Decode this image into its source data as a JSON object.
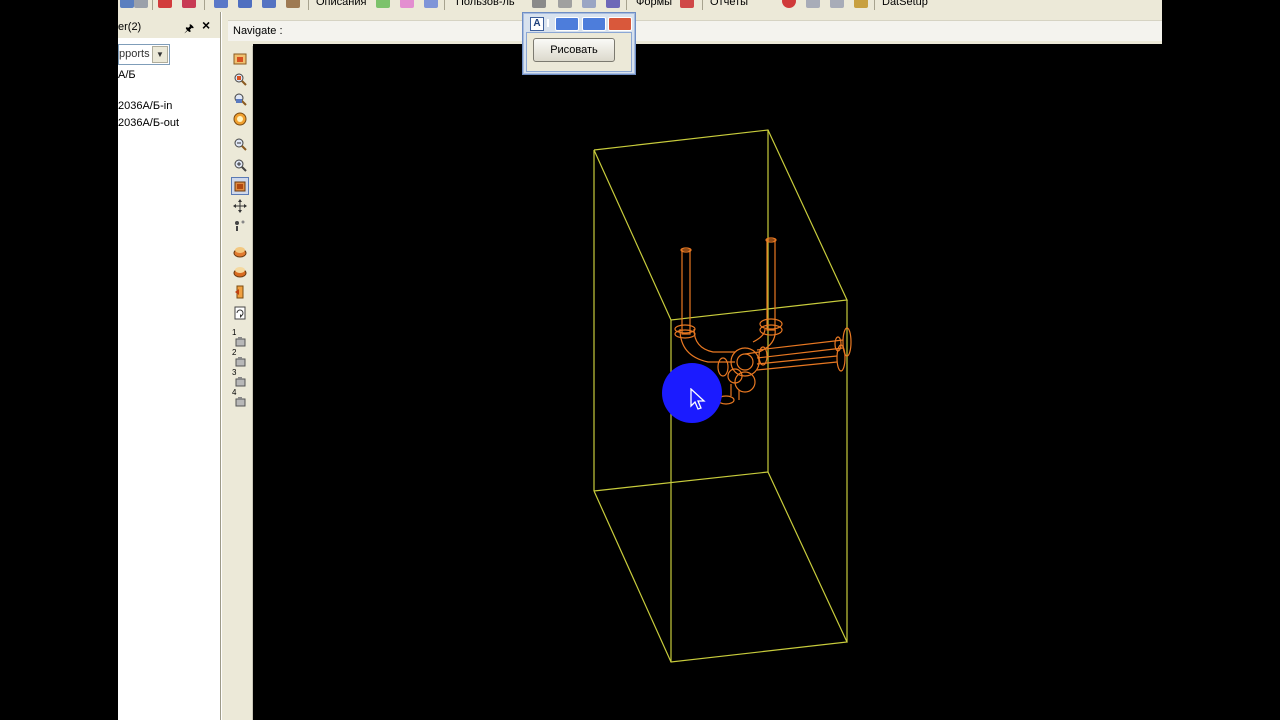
{
  "toolbar": {
    "menu_description": "Описания",
    "menu_user": "Пользов-ль",
    "menu_forms": "Формы",
    "menu_reports": "Отчеты",
    "menu_dataset": "DatSetup"
  },
  "explorer": {
    "title": "er(2)",
    "filter_value": "pports",
    "tree_items": [
      "А/Б",
      "2036А/Б-in",
      "2036А/Б-out"
    ]
  },
  "viewport": {
    "navigate_label": "Navigate :"
  },
  "side_toolbar": {
    "view_numbers": [
      "1",
      "2",
      "3",
      "4"
    ]
  },
  "draw_dialog": {
    "title_icon": "A",
    "draw_button_label": "Рисовать"
  },
  "colors": {
    "bounding_box": "#c8cc3c",
    "piping": "#e87822",
    "cursor_highlight": "#1b1bff",
    "viewport_bg": "#000000"
  },
  "icons": {
    "side_toolbar": [
      "open-model-icon",
      "zoom-window-icon",
      "zoom-out-icon",
      "zoom-extents-icon",
      "zoom-in-icon",
      "zoom-icon",
      "shaded-view-icon",
      "pan-icon",
      "walk-icon",
      "light-icon",
      "render-icon",
      "section-icon",
      "rotate-icon",
      "saved-view-1-icon",
      "saved-view-2-icon",
      "saved-view-3-icon",
      "saved-view-4-icon"
    ]
  }
}
